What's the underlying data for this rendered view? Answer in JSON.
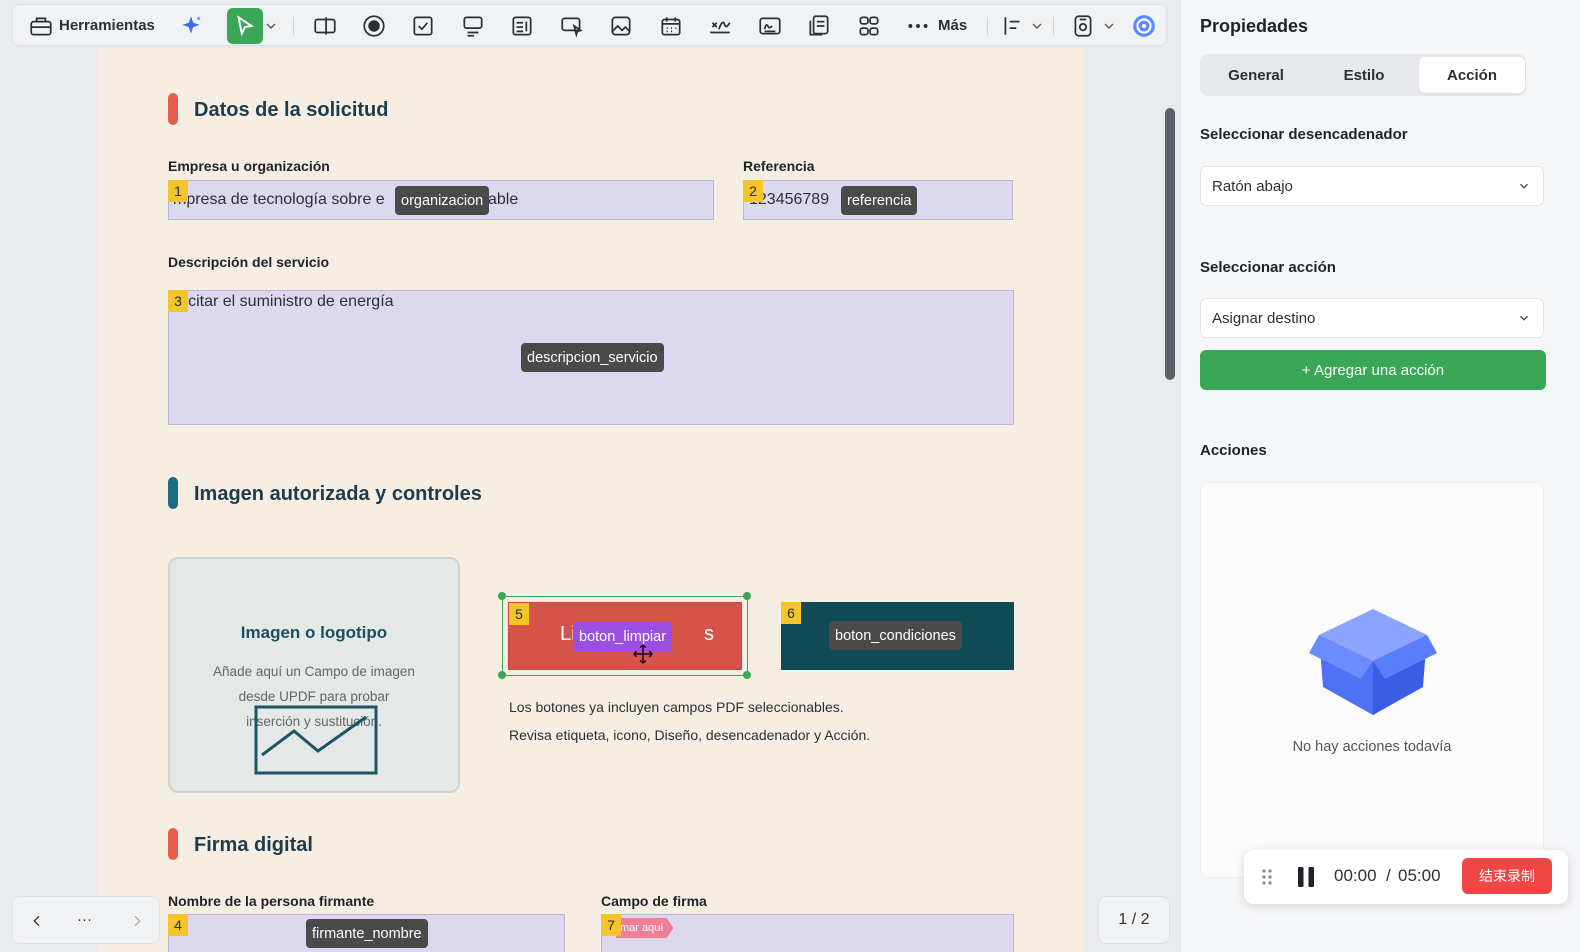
{
  "toolbar": {
    "tools_label": "Herramientas",
    "more_label": "Más"
  },
  "document": {
    "section1_title": "Datos de la solicitud",
    "label_empresa": "Empresa u organización",
    "value_empresa": "Empresa de tecnología sobre energía renovable",
    "value_empresa_visible_left": "mpresa de tecnología sobre e",
    "value_empresa_visible_right": "able",
    "tag_empresa": "organizacion",
    "label_referencia": "Referencia",
    "value_referencia": "123456789",
    "tag_referencia": "referencia",
    "label_descripcion": "Descripción del servicio",
    "value_descripcion": "licitar el suministro de energía",
    "tag_descripcion": "descripcion_servicio",
    "section2_title": "Imagen autorizada y controles",
    "image_box_title": "Imagen o logotipo",
    "image_box_text1": "Añade aquí un Campo de imagen",
    "image_box_text2": "desde UPDF para probar",
    "image_box_text3": "inserción y sustitución.",
    "button5_text_left": "Li",
    "button5_text_right": "s",
    "tag_boton_limpiar": "boton_limpiar",
    "tag_boton_condiciones": "boton_condiciones",
    "note1": "Los botones ya incluyen campos PDF seleccionables.",
    "note2": "Revisa etiqueta, icono, Diseño, desencadenador y Acción.",
    "section3_title": "Firma digital",
    "label_firmante": "Nombre de la persona firmante",
    "tag_firmante": "firmante_nombre",
    "label_campo_firma": "Campo de firma",
    "firma_placeholder": "mar aquí",
    "badges": [
      "1",
      "2",
      "3",
      "4",
      "5",
      "6",
      "7"
    ]
  },
  "nav": {
    "more": "···",
    "page_indicator": "1 / 2"
  },
  "panel": {
    "title": "Propiedades",
    "tabs": [
      "General",
      "Estilo",
      "Acción"
    ],
    "active_tab": "Acción",
    "trigger_label": "Seleccionar desencadenador",
    "trigger_value": "Ratón abajo",
    "action_label": "Seleccionar acción",
    "action_value": "Asignar destino",
    "add_action": "+ Agregar una acción",
    "actions_label": "Acciones",
    "empty_text": "No hay acciones todavía"
  },
  "recorder": {
    "elapsed": "00:00",
    "separator": "/",
    "total": "05:00",
    "stop_label": "结束录制"
  },
  "colors": {
    "accent_green": "#3aa757",
    "stop_red": "#f04646",
    "button5_red": "#d6534a",
    "button6_teal": "#0f4a55",
    "field_fill": "#dcd9ef",
    "badge_yellow": "#f4c42b",
    "section_red": "#e35d4a",
    "section_teal": "#1d6b80"
  }
}
